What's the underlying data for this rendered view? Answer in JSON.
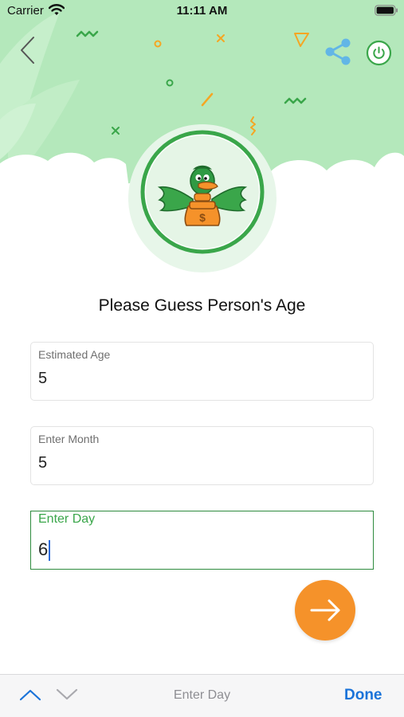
{
  "status_bar": {
    "carrier": "Carrier",
    "time": "11:11 AM"
  },
  "header": {
    "back_icon": "chevron-left-icon",
    "share_icon": "share-icon",
    "power_icon": "power-icon"
  },
  "page": {
    "title": "Please Guess Person's Age"
  },
  "form": {
    "fields": [
      {
        "label": "Estimated Age",
        "value": "5"
      },
      {
        "label": "Enter Month",
        "value": "5"
      },
      {
        "label": "Enter Day",
        "value": "6"
      }
    ],
    "next_icon": "arrow-right-icon"
  },
  "accessory_bar": {
    "title": "Enter Day",
    "done_label": "Done"
  },
  "colors": {
    "header_green": "#b4e8bb",
    "accent_green": "#3aa64a",
    "next_orange": "#f5922a",
    "done_blue": "#1a73d9"
  }
}
